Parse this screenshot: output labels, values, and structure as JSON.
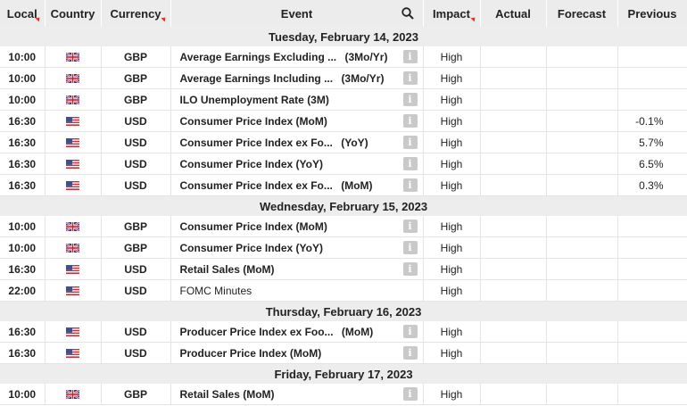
{
  "headers": {
    "local": "Local",
    "country": "Country",
    "currency": "Currency",
    "event": "Event",
    "impact": "Impact",
    "actual": "Actual",
    "forecast": "Forecast",
    "previous": "Previous"
  },
  "days": [
    {
      "date": "Tuesday, February 14, 2023",
      "rows": [
        {
          "time": "10:00",
          "country": "uk-flag-icon",
          "currency": "GBP",
          "event": "Average Earnings Excluding ...",
          "period": "(3Mo/Yr)",
          "impact": "High",
          "actual": "",
          "forecast": "",
          "previous": ""
        },
        {
          "time": "10:00",
          "country": "uk-flag-icon",
          "currency": "GBP",
          "event": "Average Earnings Including ...",
          "period": "(3Mo/Yr)",
          "impact": "High",
          "actual": "",
          "forecast": "",
          "previous": ""
        },
        {
          "time": "10:00",
          "country": "uk-flag-icon",
          "currency": "GBP",
          "event": "ILO Unemployment Rate (3M)",
          "period": "",
          "impact": "High",
          "actual": "",
          "forecast": "",
          "previous": ""
        },
        {
          "time": "16:30",
          "country": "us-flag-icon",
          "currency": "USD",
          "event": "Consumer Price Index (MoM)",
          "period": "",
          "impact": "High",
          "actual": "",
          "forecast": "",
          "previous": "-0.1%"
        },
        {
          "time": "16:30",
          "country": "us-flag-icon",
          "currency": "USD",
          "event": "Consumer Price Index ex Fo...",
          "period": "(YoY)",
          "impact": "High",
          "actual": "",
          "forecast": "",
          "previous": "5.7%"
        },
        {
          "time": "16:30",
          "country": "us-flag-icon",
          "currency": "USD",
          "event": "Consumer Price Index (YoY)",
          "period": "",
          "impact": "High",
          "actual": "",
          "forecast": "",
          "previous": "6.5%"
        },
        {
          "time": "16:30",
          "country": "us-flag-icon",
          "currency": "USD",
          "event": "Consumer Price Index ex Fo...",
          "period": "(MoM)",
          "impact": "High",
          "actual": "",
          "forecast": "",
          "previous": "0.3%"
        }
      ]
    },
    {
      "date": "Wednesday, February 15, 2023",
      "rows": [
        {
          "time": "10:00",
          "country": "uk-flag-icon",
          "currency": "GBP",
          "event": "Consumer Price Index (MoM)",
          "period": "",
          "impact": "High",
          "actual": "",
          "forecast": "",
          "previous": ""
        },
        {
          "time": "10:00",
          "country": "uk-flag-icon",
          "currency": "GBP",
          "event": "Consumer Price Index (YoY)",
          "period": "",
          "impact": "High",
          "actual": "",
          "forecast": "",
          "previous": ""
        },
        {
          "time": "16:30",
          "country": "us-flag-icon",
          "currency": "USD",
          "event": "Retail Sales (MoM)",
          "period": "",
          "impact": "High",
          "actual": "",
          "forecast": "",
          "previous": ""
        },
        {
          "time": "22:00",
          "country": "us-flag-icon",
          "currency": "USD",
          "event": "FOMC Minutes",
          "period": "",
          "impact": "High",
          "actual": "",
          "forecast": "",
          "previous": "",
          "light": true,
          "noinfo": true
        }
      ]
    },
    {
      "date": "Thursday, February 16, 2023",
      "rows": [
        {
          "time": "16:30",
          "country": "us-flag-icon",
          "currency": "USD",
          "event": "Producer Price Index ex Foo...",
          "period": "(MoM)",
          "impact": "High",
          "actual": "",
          "forecast": "",
          "previous": ""
        },
        {
          "time": "16:30",
          "country": "us-flag-icon",
          "currency": "USD",
          "event": "Producer Price Index (MoM)",
          "period": "",
          "impact": "High",
          "actual": "",
          "forecast": "",
          "previous": ""
        }
      ]
    },
    {
      "date": "Friday, February 17, 2023",
      "rows": [
        {
          "time": "10:00",
          "country": "uk-flag-icon",
          "currency": "GBP",
          "event": "Retail Sales (MoM)",
          "period": "",
          "impact": "High",
          "actual": "",
          "forecast": "",
          "previous": ""
        }
      ]
    }
  ],
  "info_glyph": "i"
}
